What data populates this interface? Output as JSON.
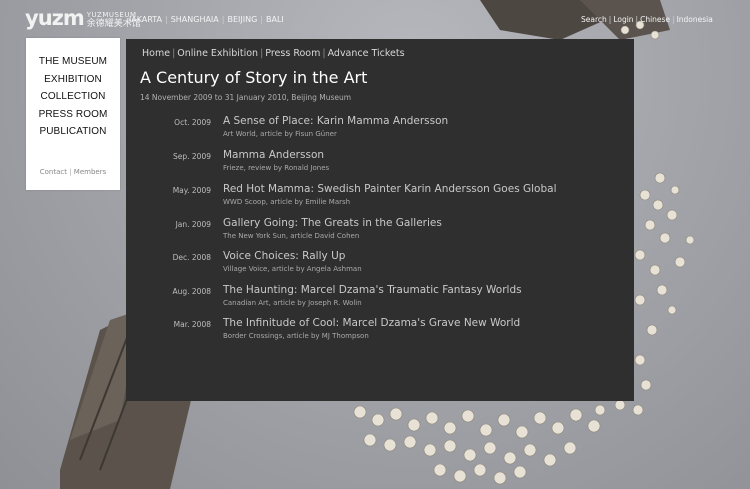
{
  "logo": {
    "mark": "yuzm",
    "sub_en": "YUZMUSEUM",
    "sub_cn": "余德耀美术馆",
    "logo_name": "yuz-museum-logo"
  },
  "cities": [
    "JAKARTA",
    "SHANGHAIA",
    "BEIJING",
    "BALI"
  ],
  "toplinks": [
    "Search",
    "Login",
    "Chinese",
    "Indonesia"
  ],
  "nav": {
    "items": [
      "THE MUSEUM",
      "EXHIBITION",
      "COLLECTION",
      "PRESS ROOM",
      "PUBLICATION"
    ],
    "footer": [
      "Contact",
      "Members"
    ]
  },
  "breadcrumb": [
    "Home",
    "Online Exhibition",
    "Press Room",
    "Advance Tickets"
  ],
  "page": {
    "title": "A Century of Story in the Art",
    "subtitle": "14 November 2009 to 31 January 2010, Beijing Museum"
  },
  "articles": [
    {
      "date": "Oct. 2009",
      "headline": "A Sense of Place: Karin Mamma Andersson",
      "source": "Art World, article by Fisun Güner"
    },
    {
      "date": "Sep. 2009",
      "headline": "Mamma Andersson",
      "source": "Frieze, review by Ronald Jones"
    },
    {
      "date": "May. 2009",
      "headline": "Red Hot Mamma: Swedish Painter Karin Andersson Goes Global",
      "source": "WWD Scoop, article by Emilie Marsh"
    },
    {
      "date": "Jan. 2009",
      "headline": "Gallery Going: The Greats in the Galleries",
      "source": "The New York Sun, article David Cohen"
    },
    {
      "date": "Dec. 2008",
      "headline": "Voice Choices: Rally Up",
      "source": "Village Voice, article by Angela Ashman"
    },
    {
      "date": "Aug. 2008",
      "headline": "The Haunting: Marcel Dzama's Traumatic Fantasy Worlds",
      "source": "Canadian Art, article by Joseph R. Wolin"
    },
    {
      "date": "Mar. 2008",
      "headline": "The Infinitude of Cool: Marcel Dzama's Grave New World",
      "source": "Border Crossings, article by MJ Thompson"
    }
  ],
  "colors": {
    "panel": "#2f2f2f",
    "nav_bg": "#ffffff",
    "page_bg": "#9fa1a6"
  }
}
